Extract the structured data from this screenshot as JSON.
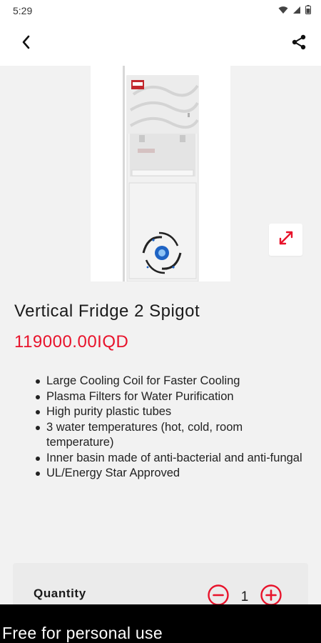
{
  "status_bar": {
    "time": "5:29",
    "icons": [
      "wifi-icon",
      "signal-icon",
      "battery-icon"
    ]
  },
  "app_bar": {
    "back_icon": "chevron-left-icon",
    "share_icon": "share-icon"
  },
  "product": {
    "title": "Vertical Fridge 2 Spigot",
    "price": "119000.00IQD",
    "features": [
      "Large Cooling Coil for Faster Cooling",
      " Plasma Filters for Water Purification",
      " High purity plastic tubes",
      "3 water temperatures (hot, cold, room temperature)",
      " Inner basin made of anti-bacterial and anti-fungal",
      "UL/Energy Star Approved"
    ]
  },
  "quantity": {
    "label": "Quantity",
    "value": "1"
  },
  "watermark": {
    "text": "Free for personal use"
  },
  "colors": {
    "accent": "#e8132b",
    "background": "#f2f2f2",
    "card": "#ebebeb"
  }
}
